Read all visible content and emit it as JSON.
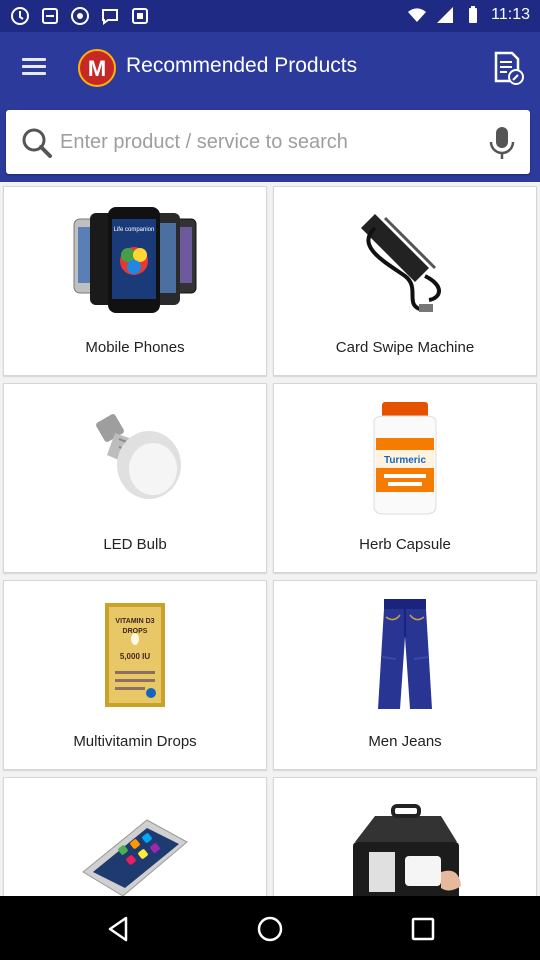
{
  "status_bar": {
    "time": "11:13",
    "icons": [
      "wifi-icon",
      "signal-icon",
      "battery-icon"
    ]
  },
  "app_bar": {
    "title": "Recommended Products",
    "logo_letter": "M",
    "menu_icon": "hamburger-menu-icon",
    "action_icon": "document-edit-icon"
  },
  "search": {
    "placeholder": "Enter product / service to search",
    "value": "",
    "icons": [
      "search-icon",
      "microphone-icon"
    ]
  },
  "products": [
    {
      "label": "Mobile Phones",
      "icon": "mobile-phones-image"
    },
    {
      "label": "Card Swipe Machine",
      "icon": "card-swipe-machine-image"
    },
    {
      "label": "LED Bulb",
      "icon": "led-bulb-image"
    },
    {
      "label": "Herb Capsule",
      "icon": "herb-capsule-image"
    },
    {
      "label": "Multivitamin Drops",
      "icon": "multivitamin-drops-image"
    },
    {
      "label": "Men Jeans",
      "icon": "men-jeans-image"
    },
    {
      "label": "",
      "icon": "smartphone-image"
    },
    {
      "label": "",
      "icon": "equipment-case-image"
    }
  ],
  "product_image_text": {
    "phone_screen": "Life companion",
    "capsule_label": "Turmeric",
    "drops_line1": "VITAMIN D3",
    "drops_line2": "DROPS",
    "drops_line3": "5,000 IU"
  },
  "nav_bar": {
    "icons": [
      "back-icon",
      "home-icon",
      "recents-icon"
    ]
  },
  "colors": {
    "status_bar": "#1f2a85",
    "app_bar": "#2b3a9b",
    "grid_background": "#f2f2f2",
    "card_background": "#ffffff"
  }
}
